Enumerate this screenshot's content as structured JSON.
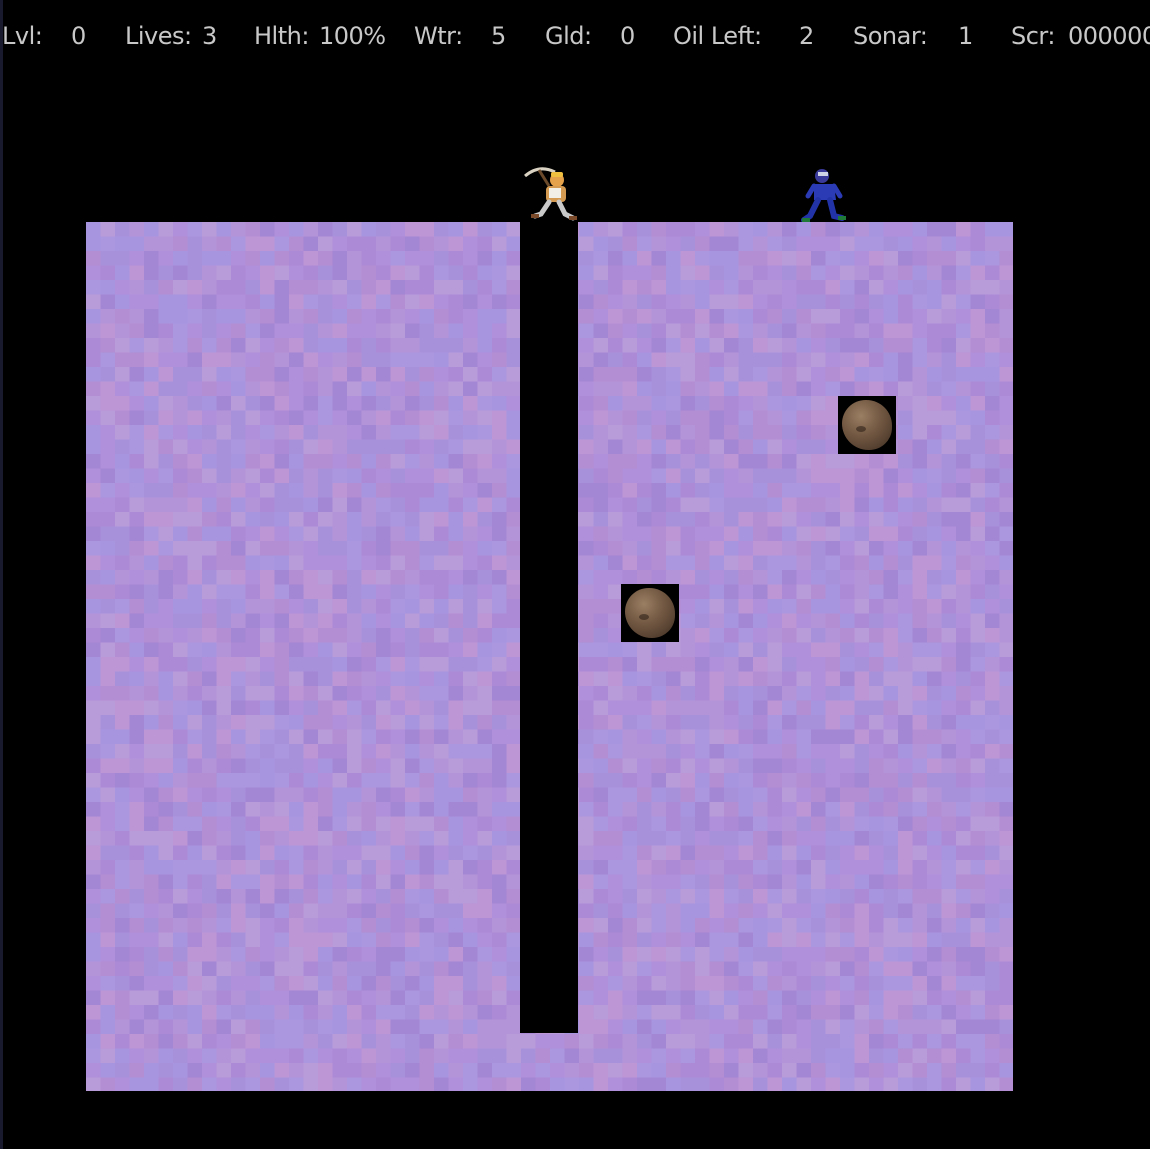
{
  "hud": {
    "level_label": "Lvl:",
    "level_value": "0",
    "lives_label": "Lives:",
    "lives_value": "3",
    "health_label": "Hlth:",
    "health_value": "100%",
    "water_label": "Wtr:",
    "water_value": "5",
    "gold_label": "Gld:",
    "gold_value": "0",
    "oil_label": "Oil Left:",
    "oil_value": "2",
    "sonar_label": "Sonar:",
    "sonar_value": "1",
    "score_label": "Scr:",
    "score_value": "000000"
  },
  "colors": {
    "background": "#000000",
    "dirt_base": "#b08fdb",
    "hud_text": "#c8c8c8",
    "boulder": "#7a5f48"
  },
  "entities": {
    "player": "tunnelman-miner-sprite",
    "protester": "protester-sprite",
    "boulders": [
      "boulder-sprite",
      "boulder-sprite"
    ]
  }
}
